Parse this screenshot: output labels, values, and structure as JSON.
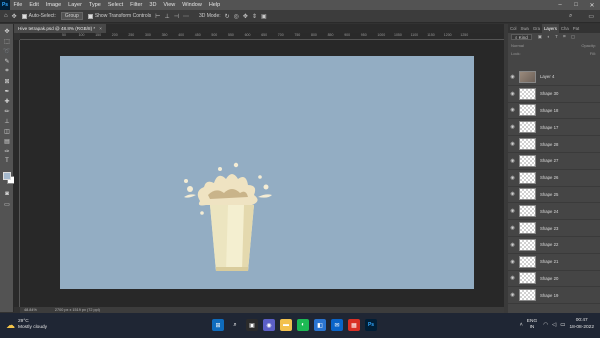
{
  "app": {
    "logo": "Ps",
    "menu": [
      "File",
      "Edit",
      "Image",
      "Layer",
      "Type",
      "Select",
      "Filter",
      "3D",
      "View",
      "Window",
      "Help"
    ]
  },
  "options": {
    "auto_select": "Auto-Select:",
    "group": "Group",
    "transform": "Show Transform Controls",
    "mode_3d": "3D Mode:"
  },
  "document": {
    "tab_title": "Hive tetrapak.psd @ 48.8% (RGB/8) *"
  },
  "ruler_labels": [
    "50",
    "100",
    "150",
    "200",
    "250",
    "300",
    "350",
    "400",
    "450",
    "500",
    "550",
    "600",
    "650",
    "700",
    "750",
    "800",
    "850",
    "900",
    "950",
    "1000",
    "1050",
    "1100",
    "1150",
    "1200",
    "1250"
  ],
  "canvas": {
    "background": "#93adc3"
  },
  "status": {
    "zoom": "48.84%",
    "size": "2700 px x 1519 px (72 ppi)"
  },
  "panel": {
    "tabs": [
      "Col",
      "Swa",
      "Gra",
      "Layers",
      "Cha",
      "Pat"
    ],
    "filter_label": "Kind",
    "opacity": "Opacity:",
    "normal": "Normal",
    "lock": "Lock:",
    "fill": "Fill:",
    "layers": [
      {
        "name": "Layer 4",
        "photo": true
      },
      {
        "name": "Shape 30"
      },
      {
        "name": "Shape 18"
      },
      {
        "name": "Shape 17"
      },
      {
        "name": "Shape 28"
      },
      {
        "name": "Shape 27"
      },
      {
        "name": "Shape 26"
      },
      {
        "name": "Shape 25"
      },
      {
        "name": "Shape 24"
      },
      {
        "name": "Shape 23"
      },
      {
        "name": "Shape 22"
      },
      {
        "name": "Shape 21"
      },
      {
        "name": "Shape 20"
      },
      {
        "name": "Shape 19"
      }
    ]
  },
  "taskbar": {
    "temperature": "29°C",
    "weather": "Mostly cloudy",
    "lang_top": "ENG",
    "lang_bottom": "IN",
    "time": "00:47",
    "date": "18-08-2022"
  }
}
